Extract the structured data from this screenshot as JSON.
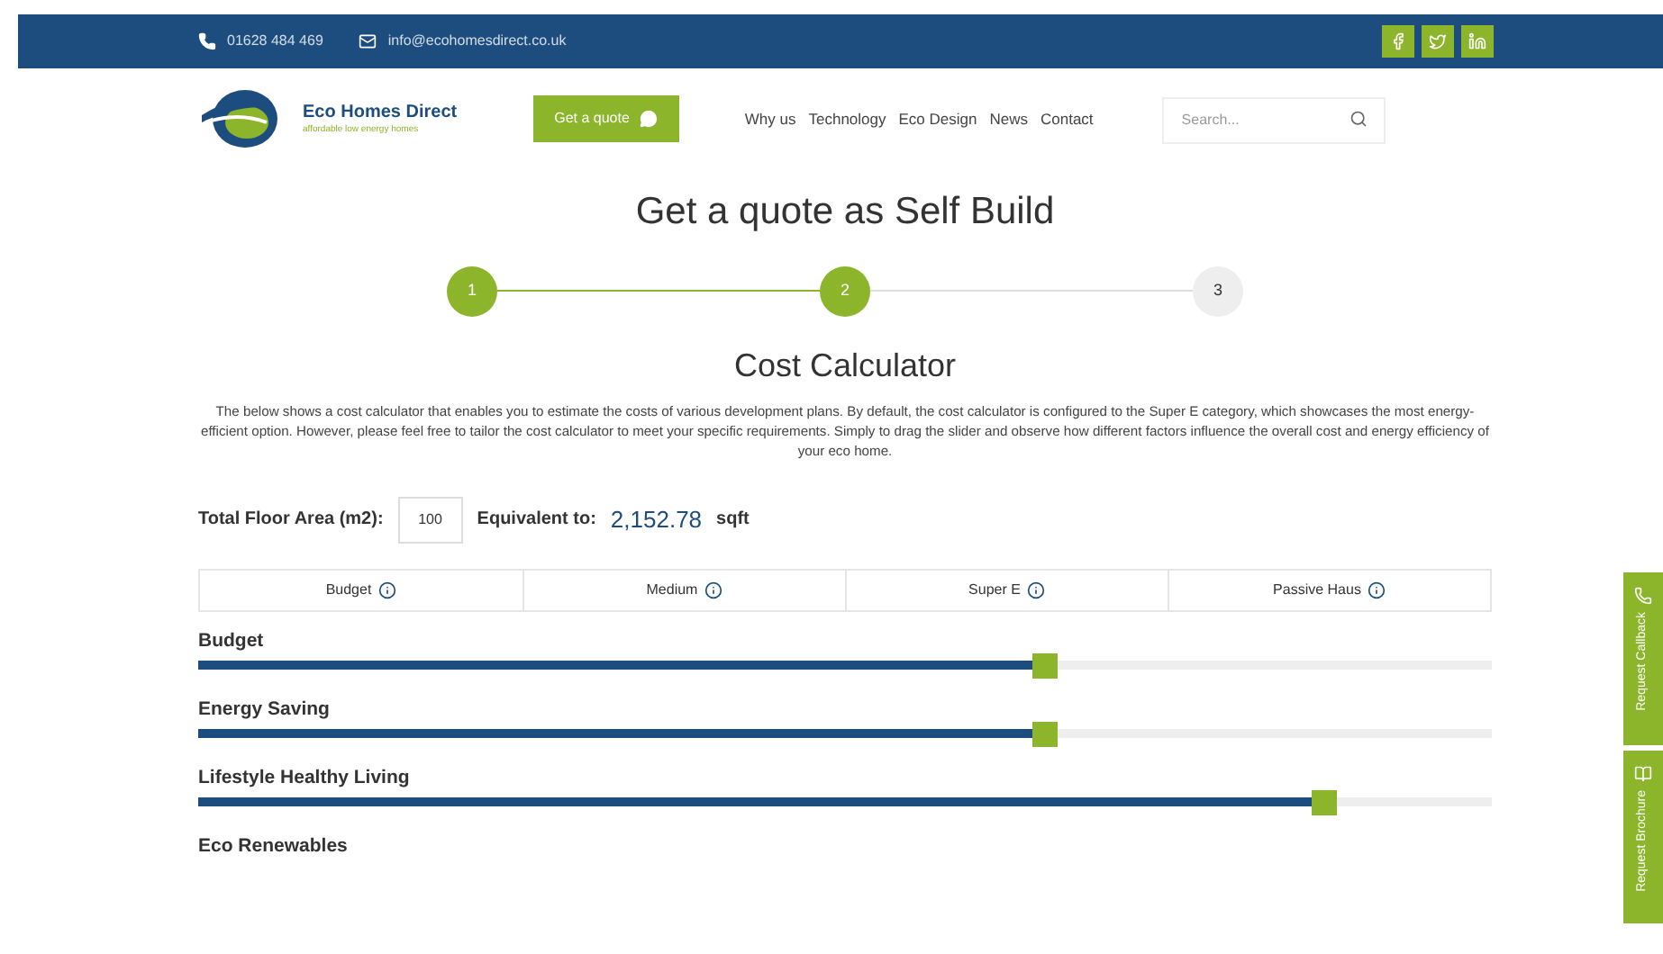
{
  "top_bar": {
    "phone": "01628 484 469",
    "email": "info@ecohomesdirect.co.uk"
  },
  "header": {
    "logo_name": "Eco Homes Direct",
    "logo_tagline": "affordable low energy homes",
    "quote_button": "Get a quote",
    "nav": [
      "Why us",
      "Technology",
      "Eco Design",
      "News",
      "Contact"
    ],
    "search": {
      "placeholder": "Search..."
    }
  },
  "title": "Get a quote as Self Build",
  "steps": [
    {
      "label": "1",
      "done": true
    },
    {
      "label": "2",
      "done": true
    },
    {
      "label": "3",
      "done": false
    }
  ],
  "calculator": {
    "heading": "Cost Calculator",
    "description": "The below shows a cost calculator that enables you to estimate the costs of various development plans. By default, the cost calculator is configured to the Super E category, which showcases the most energy-efficient option. However, please feel free to tailor the cost calculator to meet your specific requirements. Simply to drag the slider and observe how different factors influence the overall cost and energy efficiency of your eco home.",
    "floor_area_label": "Total Floor Area (m2):",
    "floor_area_value": "100",
    "equivalent_label": "Equivalent to:",
    "equivalent_value": "2,152.78",
    "equivalent_unit": "sqft",
    "categories": [
      "Budget",
      "Medium",
      "Super E",
      "Passive Haus"
    ],
    "sliders": [
      {
        "label": "Budget",
        "level": 0.655
      },
      {
        "label": "Energy Saving",
        "level": 0.655
      },
      {
        "label": "Lifestyle Healthy Living",
        "level": 0.87
      },
      {
        "label": "Eco Renewables"
      }
    ]
  },
  "side_tabs": [
    {
      "label": "Request Callback"
    },
    {
      "label": "Request Brochure"
    }
  ]
}
